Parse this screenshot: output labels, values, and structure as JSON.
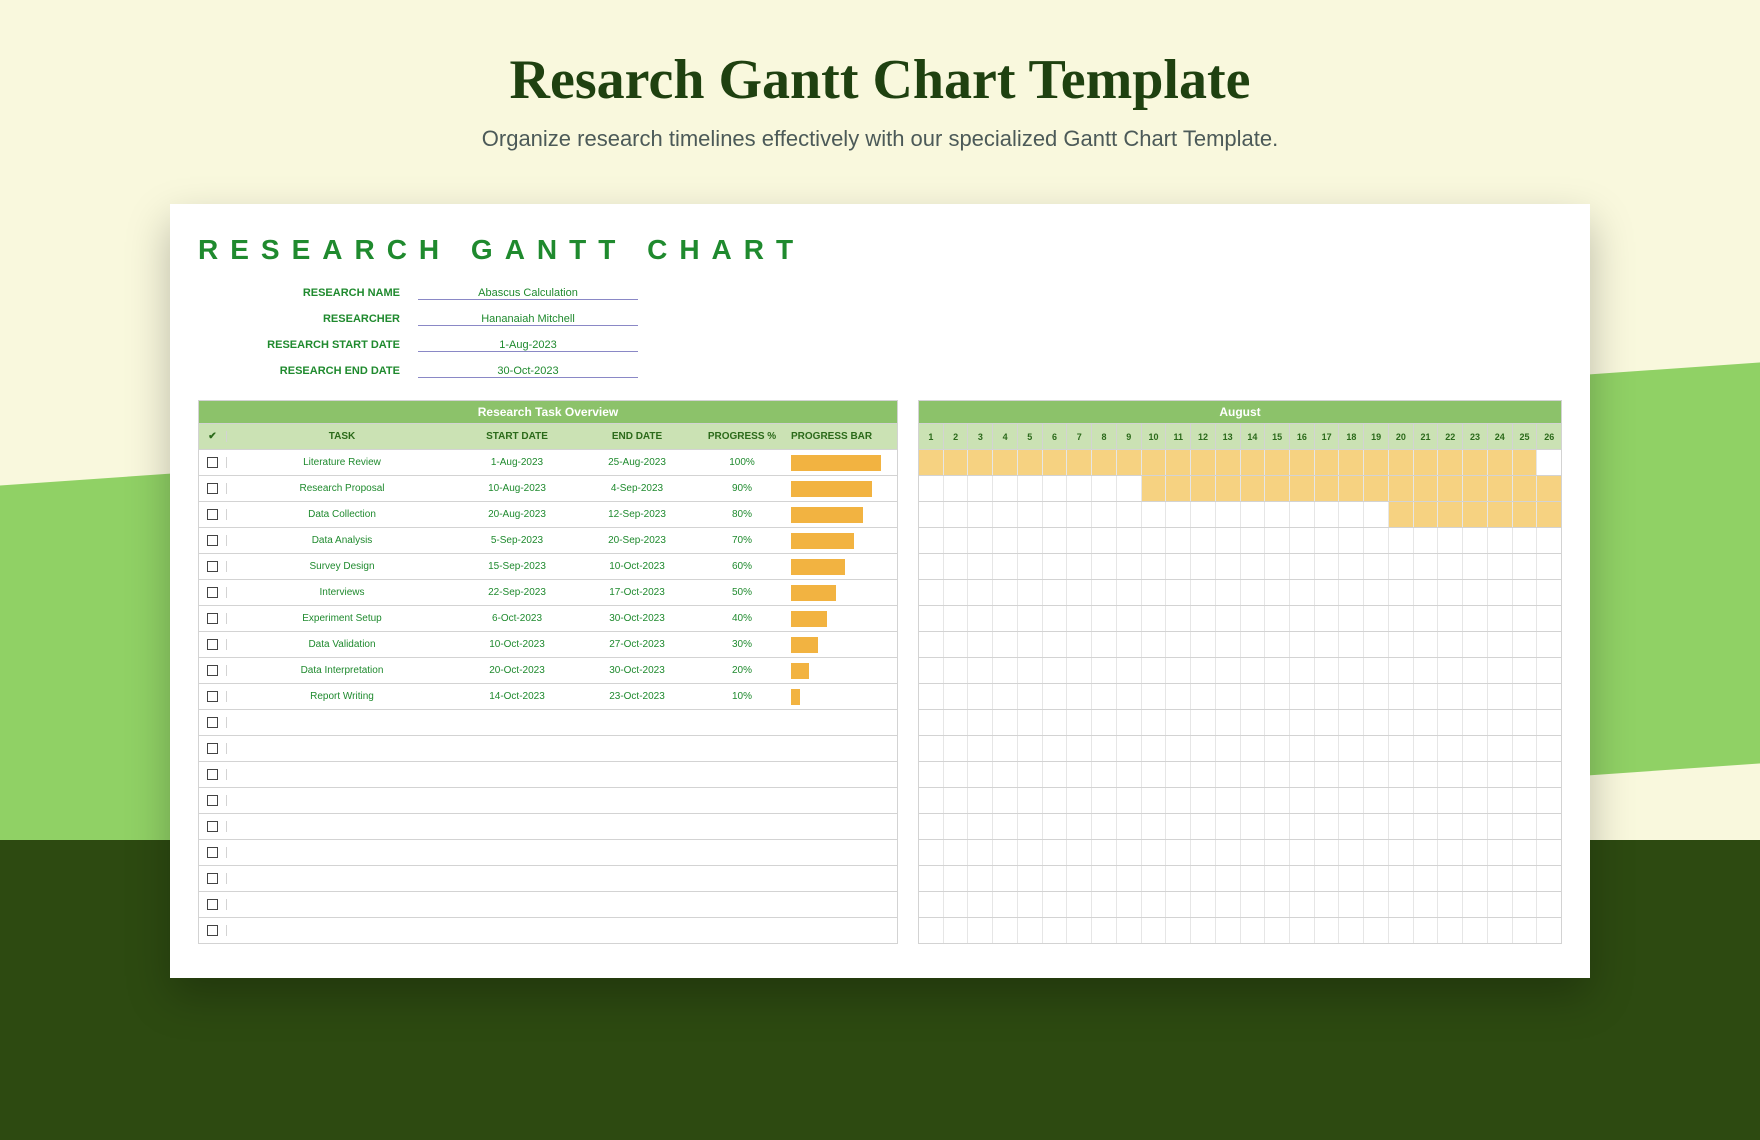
{
  "header": {
    "title": "Resarch Gantt Chart Template",
    "subtitle": "Organize research timelines effectively with our specialized Gantt Chart Template."
  },
  "chart_title": "RESEARCH GANTT CHART",
  "meta": {
    "labels": {
      "name": "RESEARCH NAME",
      "researcher": "RESEARCHER",
      "start": "RESEARCH START DATE",
      "end": "RESEARCH END DATE"
    },
    "values": {
      "name": "Abascus Calculation",
      "researcher": "Hananaiah Mitchell",
      "start": "1-Aug-2023",
      "end": "30-Oct-2023"
    }
  },
  "columns": {
    "check": "✔",
    "task": "TASK",
    "start": "START DATE",
    "end": "END DATE",
    "progress": "PROGRESS %",
    "bar": "PROGRESS BAR"
  },
  "section_heads": {
    "left": "Research Task Overview",
    "right": "August"
  },
  "chart_data": {
    "type": "gantt",
    "time_axis": {
      "month": "August",
      "days": [
        1,
        2,
        3,
        4,
        5,
        6,
        7,
        8,
        9,
        10,
        11,
        12,
        13,
        14,
        15,
        16,
        17,
        18,
        19,
        20,
        21,
        22,
        23,
        24,
        25,
        26
      ]
    },
    "tasks": [
      {
        "name": "Literature Review",
        "start": "1-Aug-2023",
        "end": "25-Aug-2023",
        "progress": 100,
        "bar_start_day": 1,
        "bar_end_day": 25
      },
      {
        "name": "Research Proposal",
        "start": "10-Aug-2023",
        "end": "4-Sep-2023",
        "progress": 90,
        "bar_start_day": 10,
        "bar_end_day": 26
      },
      {
        "name": "Data Collection",
        "start": "20-Aug-2023",
        "end": "12-Sep-2023",
        "progress": 80,
        "bar_start_day": 20,
        "bar_end_day": 26
      },
      {
        "name": "Data Analysis",
        "start": "5-Sep-2023",
        "end": "20-Sep-2023",
        "progress": 70,
        "bar_start_day": null,
        "bar_end_day": null
      },
      {
        "name": "Survey Design",
        "start": "15-Sep-2023",
        "end": "10-Oct-2023",
        "progress": 60,
        "bar_start_day": null,
        "bar_end_day": null
      },
      {
        "name": "Interviews",
        "start": "22-Sep-2023",
        "end": "17-Oct-2023",
        "progress": 50,
        "bar_start_day": null,
        "bar_end_day": null
      },
      {
        "name": "Experiment Setup",
        "start": "6-Oct-2023",
        "end": "30-Oct-2023",
        "progress": 40,
        "bar_start_day": null,
        "bar_end_day": null
      },
      {
        "name": "Data Validation",
        "start": "10-Oct-2023",
        "end": "27-Oct-2023",
        "progress": 30,
        "bar_start_day": null,
        "bar_end_day": null
      },
      {
        "name": "Data Interpretation",
        "start": "20-Oct-2023",
        "end": "30-Oct-2023",
        "progress": 20,
        "bar_start_day": null,
        "bar_end_day": null
      },
      {
        "name": "Report Writing",
        "start": "14-Oct-2023",
        "end": "23-Oct-2023",
        "progress": 10,
        "bar_start_day": null,
        "bar_end_day": null
      }
    ],
    "empty_rows": 9
  }
}
